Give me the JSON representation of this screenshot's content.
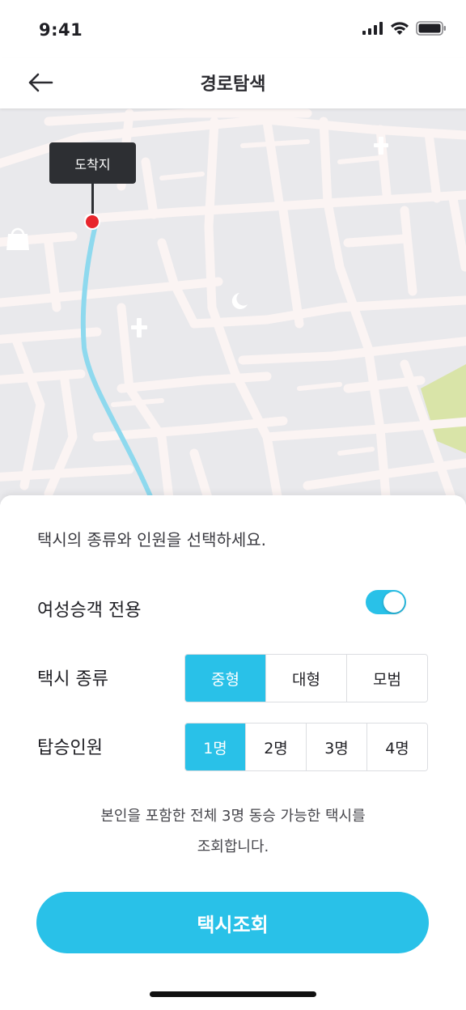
{
  "status_bar": {
    "time": "9:41"
  },
  "header": {
    "title": "경로탐색"
  },
  "map": {
    "destination_label": "도착지"
  },
  "sheet": {
    "prompt": "택시의 종류와 인원을 선택하세요.",
    "women_only": {
      "label": "여성승객 전용",
      "enabled": true
    },
    "taxi_type": {
      "label": "택시 종류",
      "options": [
        "중형",
        "대형",
        "모범"
      ],
      "selected": "중형"
    },
    "passengers": {
      "label": "탑승인원",
      "options": [
        "1명",
        "2명",
        "3명",
        "4명"
      ],
      "selected": "1명"
    },
    "info_line1": "본인을 포함한 전체 3명 동승 가능한 택시를",
    "info_line2": "조회합니다.",
    "search_button": "택시조회"
  },
  "colors": {
    "accent": "#29c1e8",
    "pin": "#e8262d",
    "map_road": "#fbf4f3",
    "map_bg": "#e9e9ec",
    "park": "#d9e4a8"
  }
}
